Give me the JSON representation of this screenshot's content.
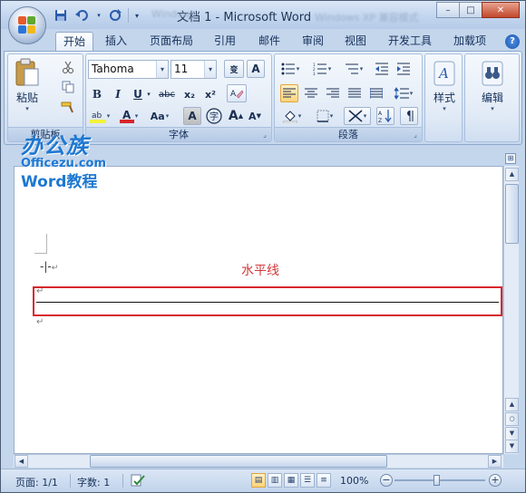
{
  "titlebar": {
    "doc_title": "文档 1 - Microsoft Word",
    "blurred_left": "Windows",
    "blurred_right": "Windows XP 兼容模式",
    "quick_access": {
      "save_icon": "save-icon",
      "undo_icon": "undo-icon",
      "redo_icon": "redo-icon"
    },
    "controls": {
      "minimize": "–",
      "maximize": "□",
      "close": "✕"
    }
  },
  "tabs": [
    {
      "label": "开始",
      "active": true
    },
    {
      "label": "插入"
    },
    {
      "label": "页面布局"
    },
    {
      "label": "引用"
    },
    {
      "label": "邮件"
    },
    {
      "label": "审阅"
    },
    {
      "label": "视图"
    },
    {
      "label": "开发工具"
    },
    {
      "label": "加载项"
    }
  ],
  "ribbon": {
    "clipboard": {
      "paste_label": "粘贴",
      "group_label": "剪贴板"
    },
    "font": {
      "font_name": "Tahoma",
      "font_size": "11",
      "group_label": "字体",
      "bold": "B",
      "italic": "I",
      "underline": "U",
      "strike": "abc",
      "subscript": "x₂",
      "superscript": "x²",
      "grow": "A",
      "shrink": "A",
      "change_case": "Aa",
      "phonetic": "变",
      "char_border": "A",
      "char_shading": "A",
      "enclose": "字"
    },
    "paragraph": {
      "group_label": "段落"
    },
    "styles": {
      "label": "样式"
    },
    "editing": {
      "label": "编辑"
    }
  },
  "watermark": {
    "brand": "办公族",
    "domain": "Officezu.com",
    "subtitle": "Word教程"
  },
  "document": {
    "callout": "水平线",
    "para_mark": "↵"
  },
  "statusbar": {
    "page": "页面: 1/1",
    "words": "字数: 1",
    "zoom": "100%",
    "zoom_minus": "−",
    "zoom_plus": "+"
  },
  "colors": {
    "accent": "#1e78d2",
    "callout_red": "#d23a3a",
    "highlight_box": "#d8262c",
    "ribbon_bg": "#d5e2f3"
  }
}
